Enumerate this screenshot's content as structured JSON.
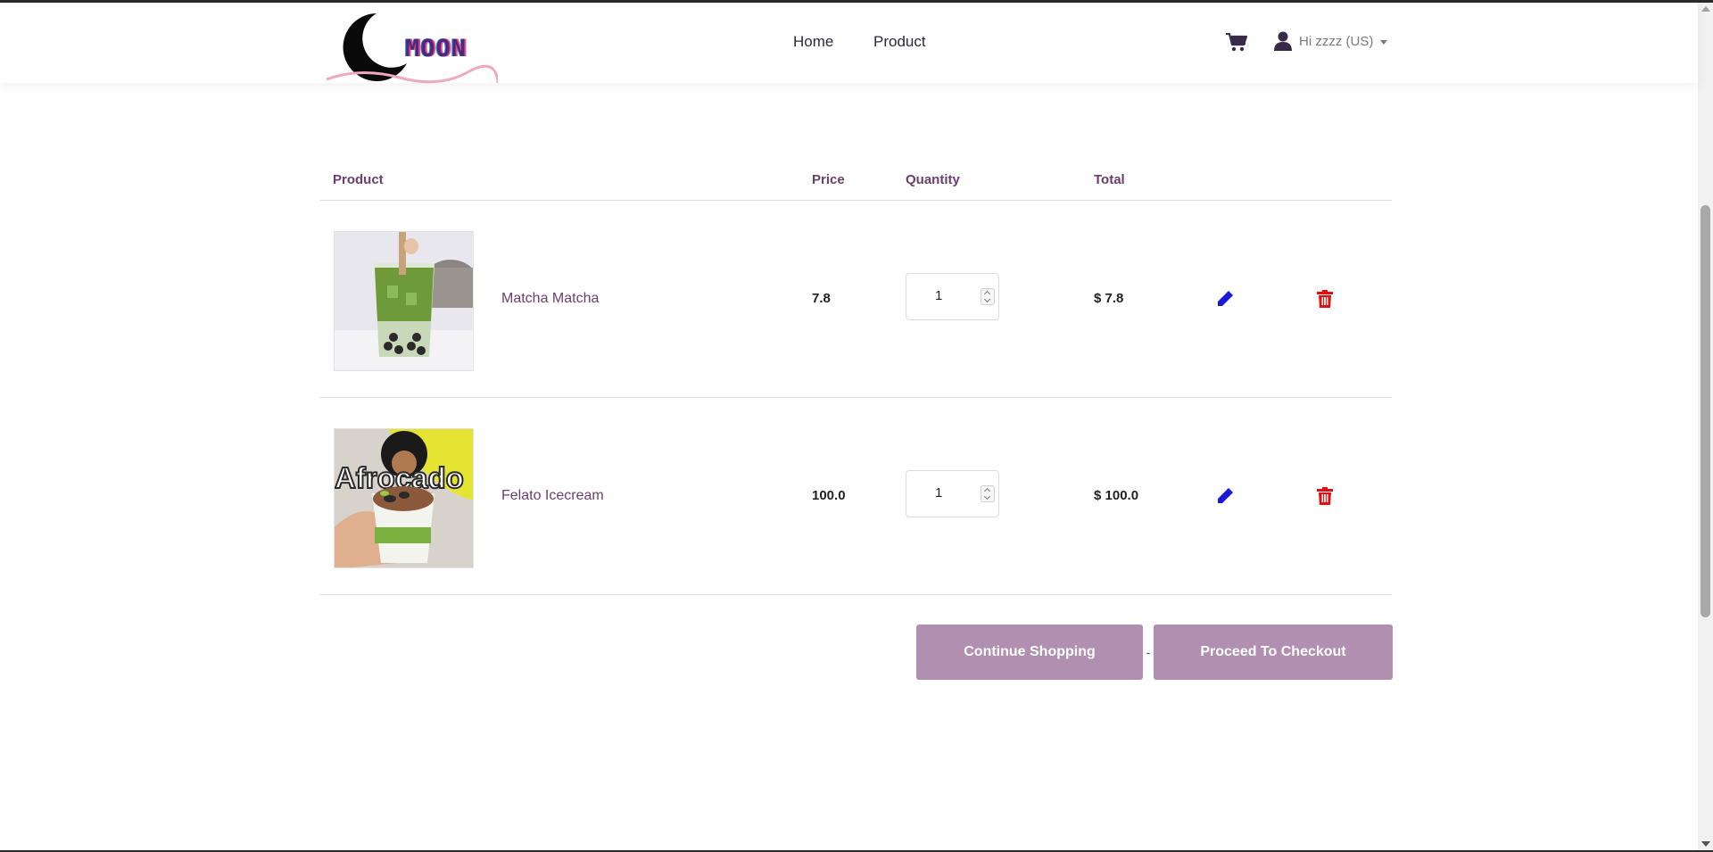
{
  "brand": {
    "name": "MOON"
  },
  "nav": {
    "items": [
      "Home",
      "Product"
    ]
  },
  "header": {
    "user_label": "Hi zzzz (US)"
  },
  "table": {
    "headers": {
      "product": "Product",
      "price": "Price",
      "quantity": "Quantity",
      "total": "Total"
    }
  },
  "cart": {
    "items": [
      {
        "name": "Matcha Matcha",
        "price": "7.8",
        "quantity": "1",
        "total": "$ 7.8"
      },
      {
        "name": "Felato Icecream",
        "price": "100.0",
        "quantity": "1",
        "total": "$ 100.0"
      }
    ]
  },
  "images": {
    "afrocado_text": "Afrocado"
  },
  "actions": {
    "continue": "Continue Shopping",
    "separator": "-",
    "checkout": "Proceed To Checkout"
  },
  "colors": {
    "accent": "#b08fb0",
    "text_accent": "#6b3f6b",
    "edit_icon": "#1a1ad8",
    "delete_icon": "#e01010"
  }
}
